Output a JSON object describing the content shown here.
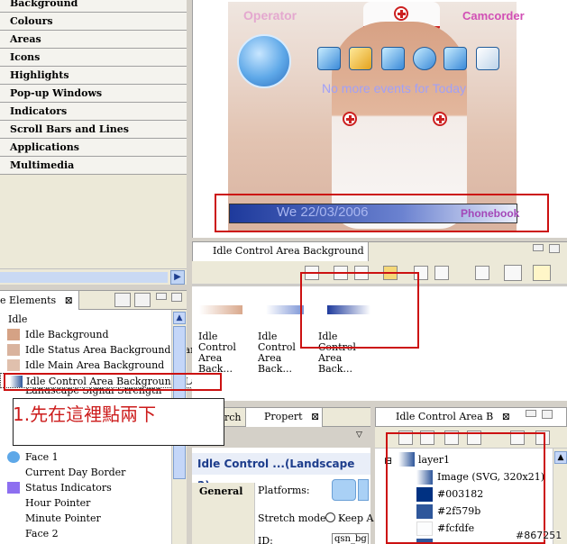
{
  "categories": [
    "Background",
    "Colours",
    "Areas",
    "Icons",
    "Highlights",
    "Pop-up Windows",
    "Indicators",
    "Scroll Bars and Lines",
    "Applications",
    "Multimedia"
  ],
  "elements_view": {
    "tab_label": "e Elements",
    "group": "Idle",
    "items": [
      {
        "label": "Idle Background",
        "icon": "nurse-thumbnail-icon",
        "color": "#d5a285"
      },
      {
        "label": "Idle Status Area Background (Land",
        "icon": "nurse-thumbnail-icon",
        "color": "#d9b39e"
      },
      {
        "label": "Idle Main Area Background",
        "icon": "nurse-thumbnail-icon",
        "color": "#e0c0ad"
      },
      {
        "label": "Idle Control Area Background (Landscape 2)",
        "icon": "blue-gradient-icon",
        "color": "#2f579b"
      },
      {
        "label": "Landscape Signal Strength",
        "icon": "signal-icon",
        "color": "#3355cc"
      },
      {
        "label": "Face 1",
        "icon": "clock-face-icon",
        "color": "#5ea8e8"
      },
      {
        "label": "Current Day Border",
        "icon": "none",
        "color": ""
      },
      {
        "label": "Status Indicators",
        "icon": "purple-square-icon",
        "color": "#8d6ff0"
      },
      {
        "label": "Hour Pointer",
        "icon": "none",
        "color": ""
      },
      {
        "label": "Minute Pointer",
        "icon": "none",
        "color": ""
      },
      {
        "label": "Face 2",
        "icon": "none",
        "color": ""
      }
    ]
  },
  "preview": {
    "operator": "Operator",
    "camcorder": "Camcorder",
    "no_events": "No more events for Today",
    "date": "We 22/03/2006",
    "phonebook": "Phonebook"
  },
  "bg_editor": {
    "tab_label": "Idle Control Area Background",
    "thumbs": [
      {
        "label": "Idle Control Area Back...",
        "color": "#d9a88c"
      },
      {
        "label": "Idle Control Area Back...",
        "color": "#7d95d6"
      },
      {
        "label": "Idle Control Area Back...",
        "color": "#2f579b"
      }
    ]
  },
  "properties": {
    "tab_search": "rch",
    "tab_label": "Propert",
    "title": "Idle Control ...(Landscape 2)",
    "section": "General",
    "platforms_label": "Platforms:",
    "stretch_label": "Stretch mode:",
    "stretch_value": "Keep A",
    "id_label": "ID:",
    "id_value": "qsn_bg"
  },
  "outline": {
    "tab_label": "Idle Control Area B",
    "layer": "layer1",
    "rows": [
      {
        "label": "Image (SVG, 320x21)",
        "color": "#2f579b"
      },
      {
        "label": "#003182",
        "color": "#003182"
      },
      {
        "label": "#2f579b",
        "color": "#2f579b"
      },
      {
        "label": "#fcfdfe",
        "color": "#fcfdfe"
      }
    ]
  },
  "annotation": "1.先在這裡點兩下",
  "watermark": "#867251"
}
